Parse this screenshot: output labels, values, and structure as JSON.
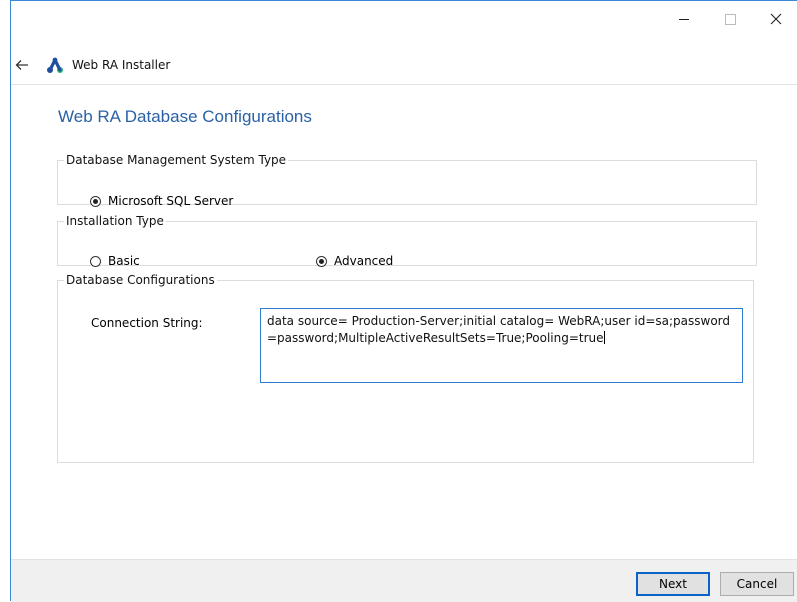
{
  "window": {
    "app_title": "Web RA Installer",
    "controls": {
      "minimize": "—",
      "maximize": "□",
      "close": "✕"
    }
  },
  "page": {
    "title": "Web RA Database Configurations"
  },
  "dbms_group": {
    "legend": "Database Management System Type",
    "options": [
      {
        "label": "Microsoft SQL Server",
        "selected": true
      }
    ]
  },
  "install_group": {
    "legend": "Installation Type",
    "options": [
      {
        "label": "Basic",
        "selected": false
      },
      {
        "label": "Advanced",
        "selected": true
      }
    ]
  },
  "config_group": {
    "legend": "Database Configurations",
    "connection_label": "Connection String:",
    "connection_value": "data source= Production-Server;initial catalog= WebRA;user id=sa;password=password;MultipleActiveResultSets=True;Pooling=true"
  },
  "footer": {
    "next_label": "Next",
    "cancel_label": "Cancel"
  },
  "colors": {
    "accent": "#2a61a6",
    "focus_border": "#2f7dd1"
  },
  "icons": {
    "back": "arrow-left-icon",
    "logo": "webra-logo-icon"
  }
}
